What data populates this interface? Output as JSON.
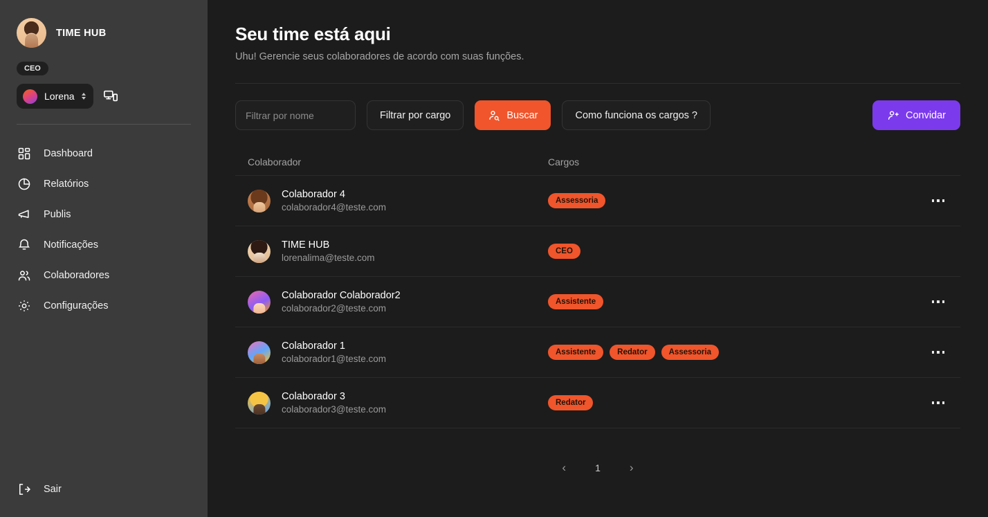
{
  "sidebar": {
    "org_name": "TIME HUB",
    "role_badge": "CEO",
    "user_name": "Lorena",
    "devices_icon": "devices-icon",
    "nav": [
      {
        "label": "Dashboard",
        "icon": "grid-icon"
      },
      {
        "label": "Relatórios",
        "icon": "pie-chart-icon"
      },
      {
        "label": "Publis",
        "icon": "megaphone-icon"
      },
      {
        "label": "Notificações",
        "icon": "bell-icon"
      },
      {
        "label": "Colaboradores",
        "icon": "users-icon"
      },
      {
        "label": "Configurações",
        "icon": "gear-icon"
      }
    ],
    "logout": {
      "label": "Sair",
      "icon": "logout-icon"
    }
  },
  "header": {
    "title": "Seu time está aqui",
    "subtitle": "Uhu! Gerencie seus colaboradores de acordo com suas funções."
  },
  "toolbar": {
    "name_filter_placeholder": "Filtrar por nome",
    "name_filter_value": "",
    "role_filter_label": "Filtrar por cargo",
    "search_label": "Buscar",
    "search_icon": "user-search-icon",
    "help_label": "Como funciona os cargos ?",
    "invite_label": "Convidar",
    "invite_icon": "user-plus-icon"
  },
  "table": {
    "columns": [
      "Colaborador",
      "Cargos"
    ],
    "rows": [
      {
        "name": "Colaborador 4",
        "email": "colaborador4@teste.com",
        "badges": [
          "Assessoria"
        ],
        "has_menu": true
      },
      {
        "name": "TIME HUB",
        "email": "lorenalima@teste.com",
        "badges": [
          "CEO"
        ],
        "has_menu": false
      },
      {
        "name": "Colaborador Colaborador2",
        "email": "colaborador2@teste.com",
        "badges": [
          "Assistente"
        ],
        "has_menu": true
      },
      {
        "name": "Colaborador 1",
        "email": "colaborador1@teste.com",
        "badges": [
          "Assistente",
          "Redator",
          "Assessoria"
        ],
        "has_menu": true
      },
      {
        "name": "Colaborador 3",
        "email": "colaborador3@teste.com",
        "badges": [
          "Redator"
        ],
        "has_menu": true
      }
    ]
  },
  "pagination": {
    "prev_icon": "chevron-left-icon",
    "next_icon": "chevron-right-icon",
    "current_page": "1"
  },
  "colors": {
    "accent_orange": "#f0552b",
    "accent_purple": "#7c3aed",
    "sidebar_bg": "#3b3b3b",
    "main_bg": "#1c1c1c",
    "surface": "#1f1f1f"
  }
}
